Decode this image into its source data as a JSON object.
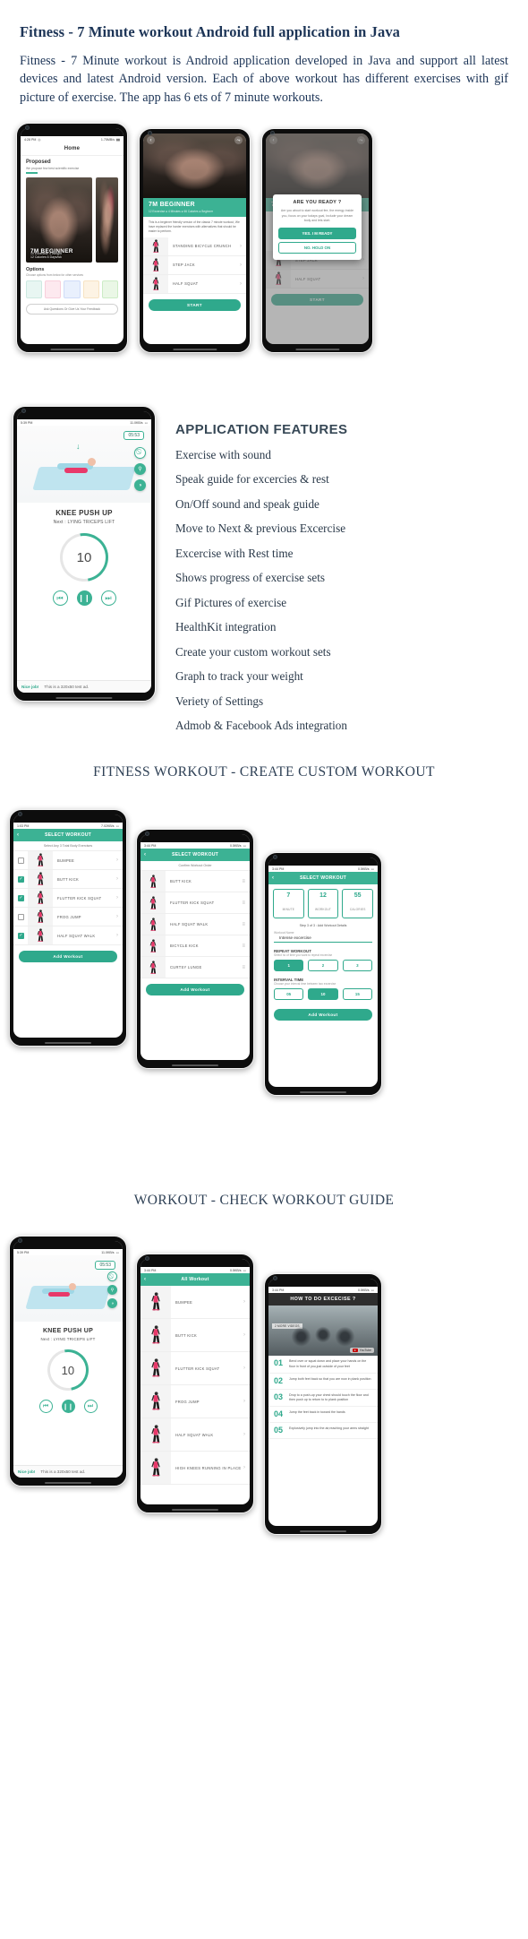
{
  "header": {
    "title": "Fitness - 7 Minute workout Android full application in Java",
    "paragraph": "Fitness - 7 Minute workout is Android application developed in Java and support  all  latest  devices and latest  Android version. Each of above workout has different exercises  with gif picture of  exercise. The  app has 6 ets of 7 minute workouts."
  },
  "features": {
    "title": "APPLICATION FEATURES",
    "items": [
      "Exercise with sound",
      "Speak guide for excercies & rest",
      "On/Off sound and speak guide",
      "Move to Next & previous Excercise",
      "Excercise with Rest time",
      "Shows progress of exercise sets",
      "Gif Pictures of exercise",
      "HealthKit integration",
      "Create your custom workout sets",
      "Graph to track your weight",
      "Veriety of Settings",
      "Admob & Facebook Ads integration"
    ]
  },
  "sections": {
    "custom_workout_title": "FITNESS WORKOUT - CREATE CUSTOM WORKOUT",
    "workout_guide_title": "WORKOUT - CHECK WORKOUT GUIDE"
  },
  "status_bar": {
    "time": "4:28 PM",
    "network": "1.75MB/s",
    "time2": "5:39 PM",
    "network2": "11.0KB/s",
    "time3": "1:03 PM",
    "network3": "7.02KB/s",
    "time4": "3:44 PM",
    "network4": "0.5KB/s"
  },
  "home_screen": {
    "appbar": "Home",
    "proposed_title": "Proposed",
    "proposed_sub": "We propose few best scientific exercise",
    "card_title": "7M BEGINNER",
    "card_sub": "10 Excercise  4 Weight\n12 Calories  6 Days/wk",
    "options_title": "Options",
    "options_sub": "Choose options from below for other services",
    "option_labels": [
      "HISTORY",
      "CUSTOM",
      "PROGRESS",
      "SETTINGS",
      "MORE"
    ],
    "feedback_btn": "Ask Questions Or Give Us Your Feedback"
  },
  "beginner_screen": {
    "title": "7M BEGINNER",
    "meta": "12 Excercise ● 4 Minutes ● 66 Calories ● Beginner",
    "description": "This is a beginner friendly version of the classic 7 minute workout, We have replaced the harder exercises with alternatives that should be easier to perform.",
    "exercises": [
      "STANDING BICYCLE CRUNCH",
      "STEP JACK",
      "HALF SQUAT"
    ],
    "start_btn": "START"
  },
  "ready_dialog": {
    "title": "ARE YOU READY ?",
    "body": "Are you about to start workout fee, the energy inside you, focus on your todays goal, Include your dream body and lets start.",
    "yes_btn": "YES. I M READY",
    "no_btn": "NO. HOLD ON",
    "exercises": [
      "STEP JACK",
      "HALF SQUAT"
    ],
    "start_btn": "START",
    "header_title": "7M BEGINNER"
  },
  "timer_screen": {
    "chip_time": "05:53",
    "exercise": "KNEE PUSH UP",
    "next": "Next : LYING TRICEPS LIFT",
    "count": "10",
    "ad_left": "Nice job!",
    "ad_right": "This is a 320x50 test ad.",
    "icons": [
      "sound-off-icon",
      "person-icon",
      "speaker-icon"
    ],
    "controls": [
      "prev-icon",
      "pause-icon",
      "next-icon"
    ]
  },
  "select_exercises_screen": {
    "appbar": "SELECT WORKOUT",
    "subtitle": "Select Any 3 Total Body Exercises",
    "rows": [
      {
        "label": "BUMPEE",
        "checked": false
      },
      {
        "label": "BUTT KICK",
        "checked": true
      },
      {
        "label": "FLUTTER KICK SQUAT",
        "checked": true
      },
      {
        "label": "FROG JUMP",
        "checked": false
      },
      {
        "label": "HALF SQUAT WALK",
        "checked": true
      }
    ],
    "add_btn": "Add Workout"
  },
  "confirm_order_screen": {
    "appbar": "SELECT WORKOUT",
    "subtitle": "Confirm Workout Order",
    "rows": [
      "BUTT KICK",
      "FLUTTER KICK SQUAT",
      "HALF SQUAT WALK",
      "BICYCLE KICK",
      "CURTSY LUNGE"
    ],
    "add_btn": "Add Workout"
  },
  "workout_details_screen": {
    "appbar": "SELECT WORKOUT",
    "stats": [
      {
        "value": "7",
        "label": "MINUTE"
      },
      {
        "value": "12",
        "label": "WORKOUT"
      },
      {
        "value": "55",
        "label": "CALORIES"
      }
    ],
    "step_label": "Step 3 of 3 : Add Workout Details",
    "field_label": "Workout Name",
    "field_value": "Intense excercise",
    "repeat_label": "REPEAT WORKOUT",
    "repeat_sub": "Select no of time you want to repeat excercise",
    "repeat_options": [
      "1",
      "2",
      "3"
    ],
    "repeat_selected": "1",
    "interval_label": "INTERVAL TIME",
    "interval_sub": "Choose your interval time between two excercise",
    "interval_options": [
      "05",
      "10",
      "15"
    ],
    "interval_selected": "10",
    "add_btn": "Add Workout"
  },
  "all_workout_screen": {
    "appbar": "All Workout",
    "rows": [
      "BUMPEE",
      "BUTT KICK",
      "FLUTTER KICK SQUAT",
      "FROG JUMP",
      "HALF SQUAT WALK",
      "HIGH KNEES RUNNING IN PLACE"
    ]
  },
  "how_to_screen": {
    "title": "HOW TO DO EXCECISE ?",
    "video_tag": "2 MORE VIDEOS",
    "video_badge": "YouTube",
    "steps": [
      {
        "num": "01",
        "text": "Bend over or squat down and place your hands on the floor in front of you,just outside of your feet"
      },
      {
        "num": "02",
        "text": "Jump both feet back so that you are now in plank position"
      },
      {
        "num": "03",
        "text": "Drop to a push-up your chest should touch the floor and then push up to return to to plank position"
      },
      {
        "num": "04",
        "text": "Jump the feet back in toward the hands"
      },
      {
        "num": "05",
        "text": "Explosively jump into the air,reaching your arms straight"
      }
    ]
  },
  "colors": {
    "accent": "#3cb294",
    "accent_dark": "#2fa98c",
    "heading": "#1d3557",
    "text": "#2b3a4a"
  }
}
